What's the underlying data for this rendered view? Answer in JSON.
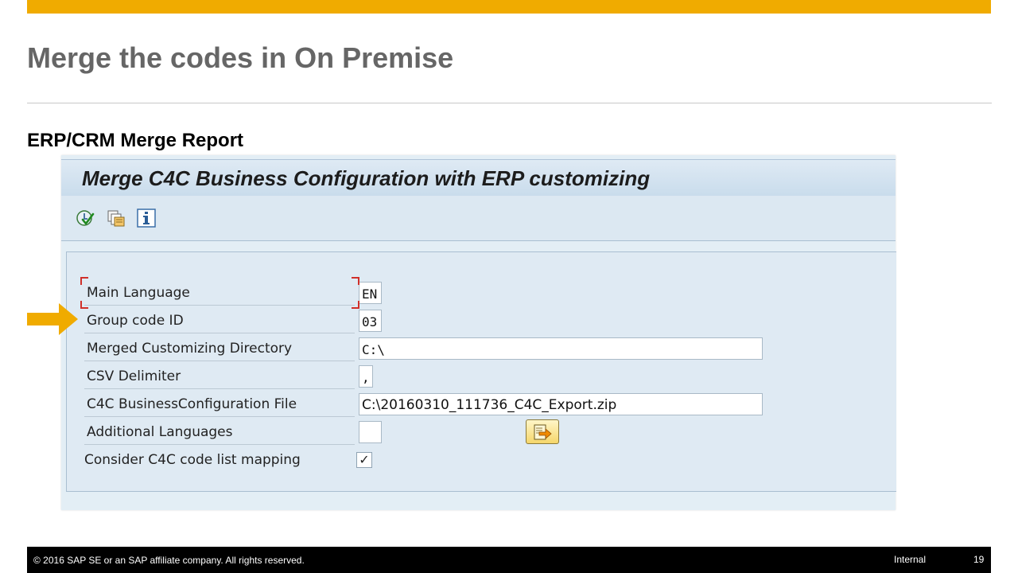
{
  "slide": {
    "title": "Merge the codes in On Premise",
    "subtitle": "ERP/CRM Merge Report"
  },
  "sap": {
    "window_title": "Merge C4C Business Configuration with ERP customizing",
    "toolbar": [
      {
        "icon": "execute-check-icon"
      },
      {
        "icon": "copy-variant-icon"
      },
      {
        "icon": "info-icon"
      }
    ],
    "fields": [
      {
        "label": "Main Language",
        "value": "EN"
      },
      {
        "label": "Group code ID",
        "value": "03"
      },
      {
        "label": "Merged Customizing Directory",
        "value": "C:\\"
      },
      {
        "label": "CSV Delimiter",
        "value": ","
      },
      {
        "label": "C4C BusinessConfiguration File",
        "value": "C:\\20160310_111736_C4C_Export.zip"
      },
      {
        "label": "Additional Languages",
        "value": ""
      },
      {
        "label": "Consider C4C code list mapping",
        "value": "✓"
      }
    ],
    "browse_icon": "file-arrow-icon"
  },
  "footer": {
    "copyright": "© 2016 SAP SE or an SAP affiliate company. All rights reserved.",
    "classification": "Internal",
    "page": "19"
  },
  "colors": {
    "accent": "#f0ab00",
    "sap_background": "#dfeaf3",
    "focus": "#d0302a"
  }
}
